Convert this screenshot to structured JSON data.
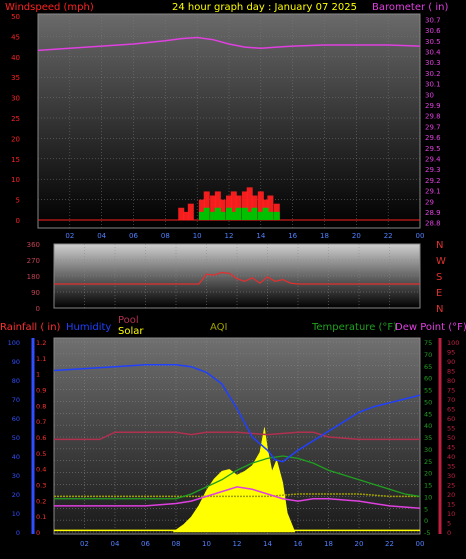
{
  "header": {
    "title": "24 hour graph day : January 07 2025",
    "left_label": "Windspeed (mph)",
    "right_label": "Barometer ( in)"
  },
  "colors": {
    "title": "#ffff00",
    "windspeed": "#ff2020",
    "gust": "#ff2020",
    "wind_green": "#00c000",
    "barometer": "#e040e0",
    "direction": "#e03030",
    "rain": "#ff3030",
    "humidity": "#2040ff",
    "pool": "#b03050",
    "solar": "#ffff00",
    "aqi": "#a0a000",
    "temperature": "#20a020",
    "dewpoint": "#e040e0",
    "axis_left": "#3050ff",
    "axis_right": "#c02040"
  },
  "x_ticks": [
    "02",
    "04",
    "06",
    "08",
    "10",
    "12",
    "14",
    "16",
    "18",
    "20",
    "22",
    "00"
  ],
  "chart_data": [
    {
      "type": "line",
      "name": "wind-baro",
      "left_axis": {
        "label": "Windspeed (mph)",
        "ticks": [
          "50",
          "45",
          "40",
          "35",
          "30",
          "25",
          "20",
          "15",
          "10",
          "5",
          "0"
        ],
        "ylim": [
          0,
          50
        ]
      },
      "right_axis": {
        "label": "Barometer ( in)",
        "ticks": [
          "30.7",
          "30.6",
          "30.5",
          "30.4",
          "30.3",
          "30.2",
          "30.1",
          "30",
          "29.9",
          "29.8",
          "29.7",
          "29.6",
          "29.5",
          "29.4",
          "29.3",
          "29.2",
          "29.1",
          "29",
          "28.9",
          "28.8"
        ],
        "ylim": [
          28.75,
          30.75
        ]
      },
      "x_range_hours": [
        0,
        24
      ],
      "series": [
        {
          "name": "Barometer",
          "axis": "right",
          "x": [
            0,
            2,
            4,
            6,
            8,
            9,
            10,
            11,
            12,
            13,
            14,
            15,
            16,
            18,
            20,
            22,
            24
          ],
          "y": [
            30.41,
            30.43,
            30.45,
            30.47,
            30.5,
            30.52,
            30.53,
            30.51,
            30.47,
            30.44,
            30.43,
            30.44,
            30.45,
            30.46,
            30.46,
            30.46,
            30.45
          ]
        },
        {
          "name": "Wind gust",
          "axis": "left",
          "x": [
            9.0,
            9.3,
            9.6,
            10.0,
            10.3,
            10.6,
            11.0,
            11.3,
            11.6,
            12.0,
            12.3,
            12.6,
            13.0,
            13.3,
            13.6,
            14.0,
            14.3,
            14.6,
            15.0
          ],
          "y": [
            3,
            2,
            4,
            0,
            5,
            7,
            6,
            7,
            5,
            6,
            7,
            6,
            7,
            8,
            6,
            7,
            5,
            6,
            4
          ]
        },
        {
          "name": "Wind average",
          "axis": "left",
          "x": [
            10.3,
            10.6,
            11.0,
            11.3,
            11.6,
            12.0,
            12.3,
            12.6,
            13.0,
            13.3,
            13.6,
            14.0,
            14.3,
            14.6,
            15.0
          ],
          "y": [
            2,
            3,
            2,
            3,
            2,
            3,
            2,
            3,
            3,
            2,
            3,
            2,
            3,
            2,
            2
          ]
        }
      ]
    },
    {
      "type": "line",
      "name": "wind-direction",
      "left_axis": {
        "ticks": [
          "360",
          "270",
          "180",
          "90",
          "0"
        ],
        "ylim": [
          0,
          360
        ]
      },
      "right_labels": [
        "N",
        "W",
        "S",
        "E",
        "N"
      ],
      "x_range_hours": [
        0,
        24
      ],
      "series": [
        {
          "name": "Wind direction",
          "x": [
            0,
            4,
            8,
            9.5,
            10,
            10.5,
            11,
            11.5,
            12,
            12.5,
            13,
            13.5,
            14,
            14.5,
            15,
            15.5,
            16,
            18,
            20,
            22,
            24
          ],
          "y": [
            135,
            135,
            135,
            135,
            190,
            185,
            200,
            195,
            165,
            150,
            170,
            140,
            175,
            150,
            160,
            140,
            135,
            135,
            135,
            135,
            135
          ]
        }
      ]
    },
    {
      "type": "line",
      "name": "weather-multi",
      "top_labels": [
        "Rainfall ( in)",
        "Humidity",
        "Pool",
        "Solar",
        "AQI",
        "Temperature (°F)",
        "Dew Point (°F)"
      ],
      "axis_rain": {
        "ticks": [
          "1.2",
          "1.1",
          "1",
          "0.9",
          "0.8",
          "0.7",
          "0.6",
          "0.5",
          "0.4",
          "0.3",
          "0.2",
          "0.1",
          "0"
        ],
        "ylim": [
          0,
          1.2
        ]
      },
      "axis_humidity": {
        "ticks": [
          "100",
          "90",
          "80",
          "70",
          "60",
          "50",
          "40",
          "30",
          "20",
          "10",
          "0"
        ],
        "ylim": [
          0,
          100
        ]
      },
      "axis_temp": {
        "ticks": [
          "75",
          "70",
          "65",
          "60",
          "55",
          "50",
          "45",
          "40",
          "35",
          "30",
          "25",
          "20",
          "15",
          "10",
          "5",
          "0",
          "-5"
        ],
        "ylim": [
          -5,
          75
        ]
      },
      "axis_dew": {
        "ticks": [
          "100",
          "95",
          "90",
          "85",
          "80",
          "75",
          "70",
          "65",
          "60",
          "55",
          "50",
          "45",
          "40",
          "35",
          "30",
          "25",
          "20",
          "15",
          "10",
          "5",
          "0"
        ],
        "ylim": [
          0,
          100
        ]
      },
      "x_range_hours": [
        0,
        24
      ],
      "series": [
        {
          "name": "Humidity",
          "axis": "humidity",
          "x": [
            0,
            2,
            4,
            6,
            8,
            9,
            10,
            11,
            12,
            13,
            14,
            14.5,
            15,
            16,
            17,
            18,
            19,
            20,
            21,
            22,
            23,
            24
          ],
          "y": [
            85,
            86,
            87,
            88,
            88,
            87,
            84,
            78,
            65,
            50,
            43,
            38,
            37,
            43,
            48,
            53,
            58,
            63,
            66,
            68,
            70,
            72
          ]
        },
        {
          "name": "Pool",
          "axis": "temp",
          "x": [
            0,
            2,
            3,
            4,
            6,
            8,
            9,
            10,
            12,
            14,
            16,
            17,
            18,
            20,
            22,
            24
          ],
          "y": [
            34,
            34,
            34,
            37,
            37,
            37,
            36,
            37,
            37,
            36,
            37,
            37,
            35,
            34,
            34,
            34
          ]
        },
        {
          "name": "Temperature",
          "axis": "temp",
          "x": [
            0,
            2,
            4,
            6,
            8,
            9,
            10,
            11,
            12,
            13,
            14,
            15,
            16,
            17,
            18,
            19,
            20,
            21,
            22,
            23,
            24
          ],
          "y": [
            9,
            9,
            9,
            9,
            9,
            11,
            14,
            17,
            21,
            24,
            26,
            27,
            26,
            24,
            21,
            19,
            17,
            15,
            13,
            11,
            10
          ]
        },
        {
          "name": "Dew Point",
          "axis": "temp",
          "x": [
            0,
            2,
            4,
            6,
            8,
            9,
            10,
            11,
            12,
            13,
            14,
            15,
            16,
            17,
            18,
            20,
            22,
            24
          ],
          "y": [
            6,
            6,
            6,
            6,
            7,
            8,
            10,
            12,
            14,
            13,
            11,
            9,
            8,
            9,
            9,
            8,
            6,
            5
          ]
        },
        {
          "name": "AQI",
          "axis": "temp",
          "x": [
            0,
            2,
            4,
            6,
            8,
            10,
            12,
            14,
            16,
            18,
            20,
            22,
            24
          ],
          "y": [
            10,
            10,
            10,
            10,
            10,
            10,
            10,
            10,
            11,
            11,
            11,
            10,
            10
          ]
        },
        {
          "name": "Rainfall",
          "axis": "rain",
          "x": [
            0,
            24
          ],
          "y": [
            0.01,
            0.01
          ]
        },
        {
          "name": "Solar",
          "axis": "solar",
          "x": [
            7.8,
            8.5,
            9,
            9.5,
            10,
            10.5,
            11,
            11.5,
            12,
            12.5,
            13,
            13.5,
            13.8,
            14,
            14.3,
            14.6,
            15,
            15.3,
            15.8
          ],
          "y": [
            0,
            4,
            8,
            14,
            22,
            28,
            32,
            33,
            30,
            32,
            35,
            42,
            55,
            44,
            32,
            38,
            26,
            10,
            0
          ],
          "ylim": [
            0,
            100
          ]
        }
      ]
    }
  ]
}
